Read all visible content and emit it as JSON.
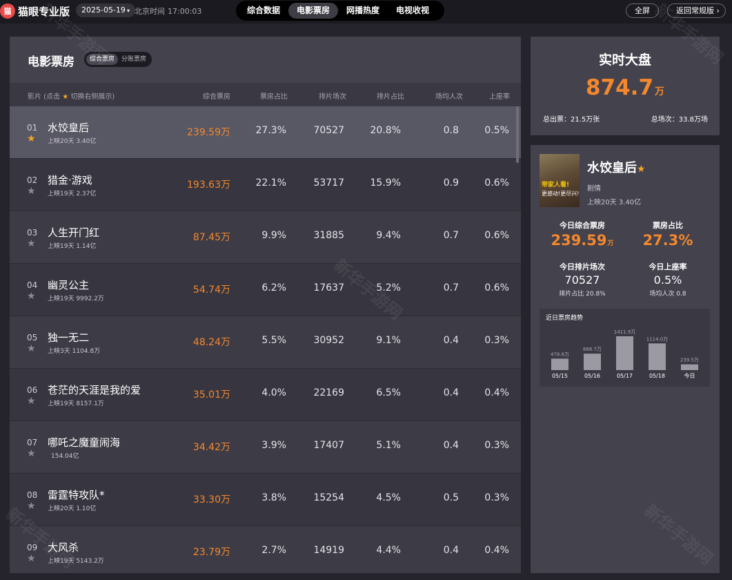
{
  "topbar": {
    "logo_badge": "猫",
    "logo_text": "猫眼专业版",
    "date": "2025-05-19",
    "clock_label": "北京时间",
    "clock_time": "17:00:03",
    "tabs": [
      {
        "label": "综合数据"
      },
      {
        "label": "电影票房"
      },
      {
        "label": "网播热度"
      },
      {
        "label": "电视收视"
      }
    ],
    "fullscreen_label": "全屏",
    "back_label": "返回常规版"
  },
  "left": {
    "title": "电影票房",
    "toggle": [
      "综合票房",
      "分账票房"
    ],
    "headers": {
      "film_prefix": "影片 (点击",
      "film_suffix": "切换右侧展示)",
      "box_office": "综合票房",
      "bo_ratio": "票房占比",
      "sessions": "排片场次",
      "session_ratio": "排片占比",
      "per_session": "场均人次",
      "occupancy": "上座率"
    },
    "rows": [
      {
        "rank": "01",
        "name": "水饺皇后",
        "meta": "上映20天  3.40亿",
        "bo": "239.59万",
        "bor": "27.3%",
        "sess": "70527",
        "sr": "20.8%",
        "ppl": "0.8",
        "occ": "0.5%"
      },
      {
        "rank": "02",
        "name": "猎金·游戏",
        "meta": "上映19天  2.37亿",
        "bo": "193.63万",
        "bor": "22.1%",
        "sess": "53717",
        "sr": "15.9%",
        "ppl": "0.9",
        "occ": "0.6%"
      },
      {
        "rank": "03",
        "name": "人生开门红",
        "meta": "上映19天  1.14亿",
        "bo": "87.45万",
        "bor": "9.9%",
        "sess": "31885",
        "sr": "9.4%",
        "ppl": "0.7",
        "occ": "0.6%"
      },
      {
        "rank": "04",
        "name": "幽灵公主",
        "meta": "上映19天  9992.2万",
        "bo": "54.74万",
        "bor": "6.2%",
        "sess": "17637",
        "sr": "5.2%",
        "ppl": "0.7",
        "occ": "0.6%"
      },
      {
        "rank": "05",
        "name": "独一无二",
        "meta": "上映3天  1104.8万",
        "bo": "48.24万",
        "bor": "5.5%",
        "sess": "30952",
        "sr": "9.1%",
        "ppl": "0.4",
        "occ": "0.3%"
      },
      {
        "rank": "06",
        "name": "苍茫的天涯是我的爱",
        "meta": "上映19天  8157.1万",
        "bo": "35.01万",
        "bor": "4.0%",
        "sess": "22169",
        "sr": "6.5%",
        "ppl": "0.4",
        "occ": "0.4%"
      },
      {
        "rank": "07",
        "name": "哪吒之魔童闹海",
        "meta": "154.04亿",
        "bo": "34.42万",
        "bor": "3.9%",
        "sess": "17407",
        "sr": "5.1%",
        "ppl": "0.4",
        "occ": "0.3%"
      },
      {
        "rank": "08",
        "name": "雷霆特攻队*",
        "meta": "上映20天  1.10亿",
        "bo": "33.30万",
        "bor": "3.8%",
        "sess": "15254",
        "sr": "4.5%",
        "ppl": "0.5",
        "occ": "0.3%"
      },
      {
        "rank": "09",
        "name": "大风杀",
        "meta": "上映19天  5143.2万",
        "bo": "23.79万",
        "bor": "2.7%",
        "sess": "14919",
        "sr": "4.4%",
        "ppl": "0.4",
        "occ": "0.4%"
      }
    ]
  },
  "realtime": {
    "title": "实时大盘",
    "value": "874.7",
    "unit": "万",
    "tickets": "总出票：21.5万张",
    "sessions": "总场次：33.8万场"
  },
  "detail": {
    "poster_text1": "带家人看!",
    "poster_text2": "更感动!更尽兴!",
    "name": "水饺皇后",
    "genre": "剧情",
    "release": "上映20天  3.40亿",
    "today_bo_label": "今日综合票房",
    "today_bo_value": "239.59",
    "today_bo_unit": "万",
    "bo_ratio_label": "票房占比",
    "bo_ratio_value": "27.3%",
    "sessions_label": "今日排片场次",
    "sessions_value": "70527",
    "sessions_sub": "排片占比 20.8%",
    "occ_label": "今日上座率",
    "occ_value": "0.5%",
    "occ_sub": "场均人次 0.8"
  },
  "watermark": "新华手游网",
  "chart_data": {
    "type": "bar",
    "title": "近日票房趋势",
    "categories": [
      "05/15",
      "05/16",
      "05/17",
      "05/18",
      "今日"
    ],
    "values": [
      478.6,
      686.7,
      1411.9,
      1114.0,
      239.5
    ],
    "value_labels": [
      "478.6万",
      "686.7万",
      "1411.9万",
      "1114.0万",
      "239.5万"
    ],
    "ylim": [
      0,
      1411.9
    ],
    "bar_color": "#9b9aa3"
  },
  "colors": {
    "accent": "#f5882d",
    "star": "#f5a623",
    "panel": "#43424d"
  }
}
